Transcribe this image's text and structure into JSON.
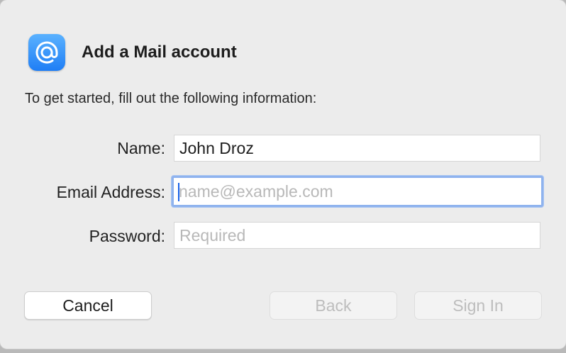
{
  "dialog": {
    "title": "Add a Mail account",
    "instructions": "To get started, fill out the following information:",
    "app_icon": "mail-at-icon",
    "accent_color": "#1f7ef5"
  },
  "form": {
    "name": {
      "label": "Name:",
      "value": "John Droz",
      "placeholder": ""
    },
    "email": {
      "label": "Email Address:",
      "value": "",
      "placeholder": "name@example.com",
      "focused": true
    },
    "password": {
      "label": "Password:",
      "value": "",
      "placeholder": "Required"
    }
  },
  "buttons": {
    "cancel": {
      "label": "Cancel",
      "enabled": true
    },
    "back": {
      "label": "Back",
      "enabled": false
    },
    "sign_in": {
      "label": "Sign In",
      "enabled": false
    }
  }
}
